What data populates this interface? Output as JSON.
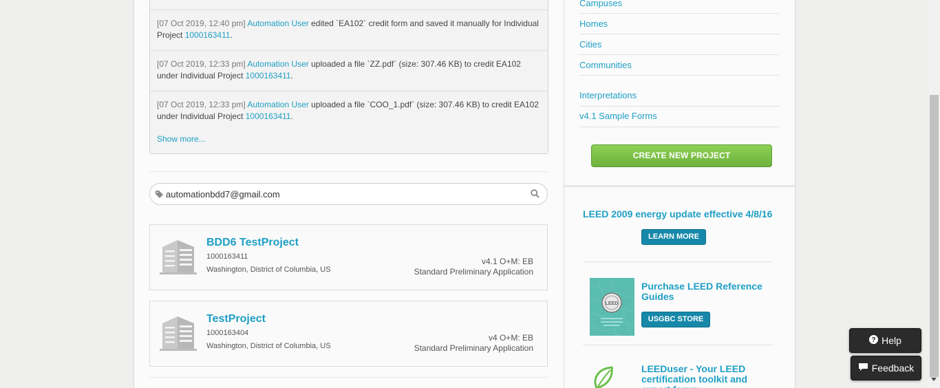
{
  "activity": {
    "items": [
      {
        "timestamp": "[07 Oct 2019, 12:40 pm]",
        "user": "Automation User",
        "text_a": " edited `EA102` credit form and saved it manually for Individual Project ",
        "project_id": "1000163411",
        "text_b": "."
      },
      {
        "timestamp": "[07 Oct 2019, 12:33 pm]",
        "user": "Automation User",
        "text_a": " uploaded a file `ZZ.pdf` (size: 307.46 KB) to credit EA102 under Individual Project ",
        "project_id": "1000163411",
        "text_b": "."
      },
      {
        "timestamp": "[07 Oct 2019, 12:33 pm]",
        "user": "Automation User",
        "text_a": " uploaded a file `COO_1.pdf` (size: 307.46 KB) to credit EA102 under Individual Project ",
        "project_id": "1000163411",
        "text_b": "."
      }
    ],
    "show_more": "Show more..."
  },
  "search": {
    "value": "automationbdd7@gmail.com"
  },
  "projects": [
    {
      "name": "BDD6 TestProject",
      "id": "1000163411",
      "location": "Washington, District of Columbia, US",
      "rating": "v4.1 O+M: EB",
      "type": "Standard Preliminary Application"
    },
    {
      "name": "TestProject",
      "id": "1000163404",
      "location": "Washington, District of Columbia, US",
      "rating": "v4 O+M: EB",
      "type": "Standard Preliminary Application"
    }
  ],
  "sidebar": {
    "links": [
      "Campuses",
      "Homes",
      "Cities",
      "Communities",
      "Interpretations",
      "v4.1 Sample Forms"
    ],
    "create_button": "CREATE NEW PROJECT",
    "promo": {
      "title": "LEED 2009 energy update effective 4/8/16",
      "learn_button": "LEARN MORE"
    },
    "book": {
      "title": "Purchase LEED Reference Guides",
      "store_button": "USGBC STORE",
      "cover_text": "LEED"
    },
    "leeduser": {
      "title": "LEEDuser - Your LEED certification toolkit and expert forum"
    }
  },
  "floating": {
    "help": "Help",
    "feedback": "Feedback"
  },
  "colors": {
    "link": "#1e9fc5",
    "create_button": "#7cc047",
    "blue_button": "#1788a9",
    "float_button": "#2b2b2b"
  }
}
